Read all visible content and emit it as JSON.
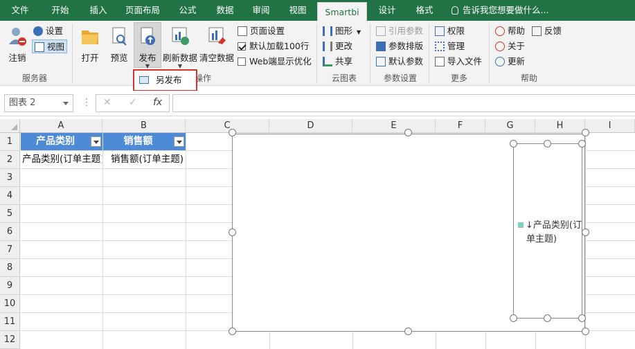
{
  "tabs": [
    "文件",
    "开始",
    "插入",
    "页面布局",
    "公式",
    "数据",
    "审阅",
    "视图",
    "Smartbi",
    "设计",
    "格式"
  ],
  "active_tab": "Smartbi",
  "tell_me": "告诉我您想要做什么...",
  "ribbon": {
    "server": {
      "logout": "注销",
      "settings": "设置",
      "view": "视图",
      "group": "服务器"
    },
    "ops": {
      "open": "打开",
      "preview": "预览",
      "publish": "发布",
      "refresh": "刷新数据",
      "clear": "清空数据",
      "page_setup": "页面设置",
      "default_load": "默认加载100行",
      "web_optimize": "Web端显示优化",
      "group": "操作"
    },
    "cloud": {
      "chart": "图形",
      "update": "更改",
      "share": "共享",
      "group": "云图表"
    },
    "params": {
      "ref_params": "引用参数",
      "param_layout": "参数排版",
      "default_params": "默认参数",
      "group": "参数设置"
    },
    "more": {
      "permission": "权限",
      "manage": "管理",
      "import_file": "导入文件",
      "group": "更多"
    },
    "help": {
      "help": "帮助",
      "feedback": "反馈",
      "about": "关于",
      "update": "更新",
      "group": "帮助"
    }
  },
  "publish_dropdown": {
    "save_as_publish": "另发布"
  },
  "formula_bar": {
    "name_box": "图表 2",
    "cancel": "✕",
    "confirm": "✓",
    "fx": "fx"
  },
  "grid": {
    "columns": [
      "A",
      "B",
      "C",
      "D",
      "E",
      "F",
      "G",
      "H",
      "I"
    ],
    "rows": [
      "1",
      "2",
      "3",
      "4",
      "5",
      "6",
      "7",
      "8",
      "9",
      "10",
      "11",
      "12"
    ],
    "header_a1": "产品类别",
    "header_b1": "销售额",
    "cell_a2": "产品类别(订单主题)",
    "cell_b2": "销售额(订单主题)"
  },
  "chart": {
    "legend_label_line1": "↓产品类别(订",
    "legend_label_line2": "单主题)",
    "legend_color": "#7ed3c0"
  },
  "colors": {
    "ribbon_tab_bg": "#217346",
    "table_header": "#4d8bd6",
    "highlight_border": "#d9312b"
  }
}
